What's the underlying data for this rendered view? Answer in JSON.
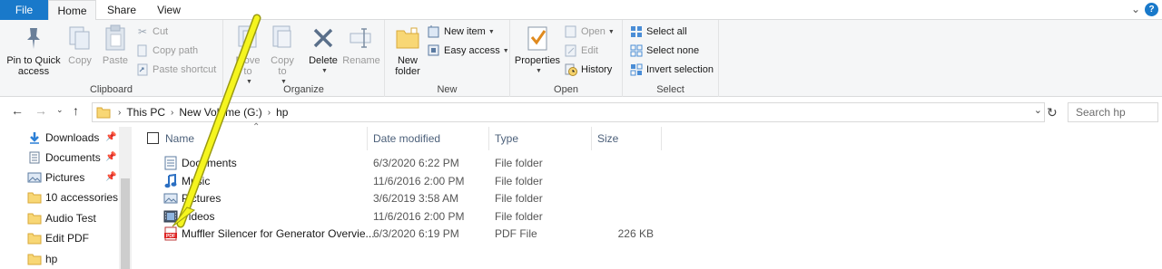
{
  "ribbon_tabs": {
    "file": "File",
    "home": "Home",
    "share": "Share",
    "view": "View"
  },
  "ribbon": {
    "clipboard": {
      "label": "Clipboard",
      "pin_label": "Pin to Quick access",
      "copy_label": "Copy",
      "paste_label": "Paste",
      "cut_label": "Cut",
      "copy_path_label": "Copy path",
      "paste_shortcut_label": "Paste shortcut"
    },
    "organize": {
      "label": "Organize",
      "move_to_label": "Move to",
      "copy_to_label": "Copy to",
      "delete_label": "Delete",
      "rename_label": "Rename"
    },
    "new": {
      "label": "New",
      "new_folder_label": "New folder",
      "new_item_label": "New item",
      "easy_access_label": "Easy access"
    },
    "open": {
      "label": "Open",
      "properties_label": "Properties",
      "open_label": "Open",
      "edit_label": "Edit",
      "history_label": "History"
    },
    "select": {
      "label": "Select",
      "select_all_label": "Select all",
      "select_none_label": "Select none",
      "invert_label": "Invert selection"
    }
  },
  "address": {
    "crumbs": [
      "This PC",
      "New Volume (G:)",
      "hp"
    ],
    "search_placeholder": "Search hp"
  },
  "nav_pane": {
    "items": [
      {
        "label": "Downloads",
        "icon": "download-arrow-icon",
        "pinned": true
      },
      {
        "label": "Documents",
        "icon": "document-icon",
        "pinned": true
      },
      {
        "label": "Pictures",
        "icon": "picture-icon",
        "pinned": true
      },
      {
        "label": "10 accessories",
        "icon": "folder-icon",
        "pinned": false
      },
      {
        "label": "Audio Test",
        "icon": "folder-icon",
        "pinned": false
      },
      {
        "label": "Edit PDF",
        "icon": "folder-icon",
        "pinned": false
      },
      {
        "label": "hp",
        "icon": "folder-icon",
        "pinned": false
      }
    ]
  },
  "file_list": {
    "columns": {
      "name": "Name",
      "date_modified": "Date modified",
      "type": "Type",
      "size": "Size"
    },
    "rows": [
      {
        "name": "Documents",
        "date": "6/3/2020 6:22 PM",
        "type": "File folder",
        "size": "",
        "icon": "documents-folder-icon"
      },
      {
        "name": "Music",
        "date": "11/6/2016 2:00 PM",
        "type": "File folder",
        "size": "",
        "icon": "music-note-icon"
      },
      {
        "name": "Pictures",
        "date": "3/6/2019 3:58 AM",
        "type": "File folder",
        "size": "",
        "icon": "pictures-folder-icon"
      },
      {
        "name": "Videos",
        "date": "11/6/2016 2:00 PM",
        "type": "File folder",
        "size": "",
        "icon": "video-folder-icon"
      },
      {
        "name": "Muffler Silencer for Generator Overvie...",
        "date": "6/3/2020 6:19 PM",
        "type": "PDF File",
        "size": "226 KB",
        "icon": "pdf-file-icon"
      }
    ]
  },
  "colors": {
    "accent": "#1979ca",
    "annotation_arrow": "#f5f51e"
  }
}
